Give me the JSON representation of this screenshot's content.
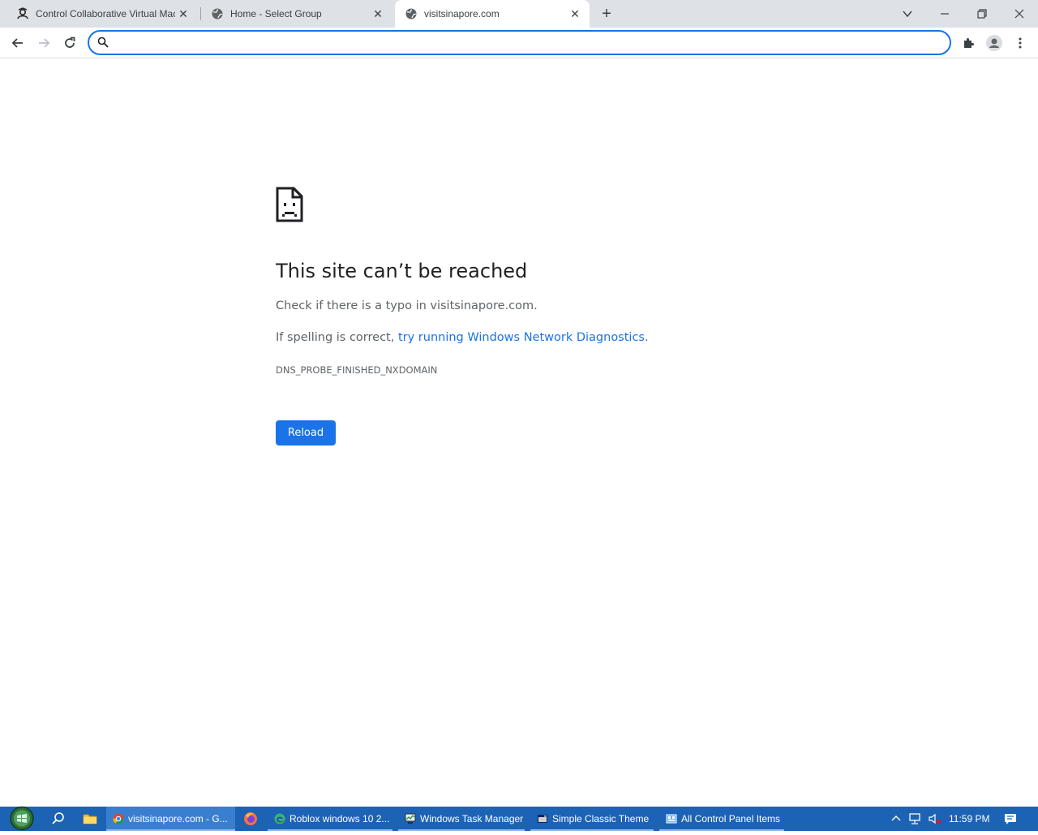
{
  "browser": {
    "tabs": [
      {
        "title": "Control Collaborative Virtual Machine",
        "favicon": "person-shield-icon",
        "active": false
      },
      {
        "title": "Home - Select Group",
        "favicon": "globe-icon",
        "active": false
      },
      {
        "title": "visitsinapore.com",
        "favicon": "globe-icon",
        "active": true
      }
    ],
    "new_tab": "+",
    "omnibox": {
      "value": "",
      "placeholder": ""
    }
  },
  "error_page": {
    "title": "This site can’t be reached",
    "typo_line": "Check if there is a typo in visitsinapore.com.",
    "spelling_prefix": "If spelling is correct, ",
    "diagnostics_link": "try running Windows Network Diagnostics",
    "spelling_suffix": ".",
    "error_code": "DNS_PROBE_FINISHED_NXDOMAIN",
    "reload_label": "Reload"
  },
  "taskbar": {
    "items": [
      {
        "label": "visitsinapore.com - G...",
        "icon": "chrome-icon",
        "active": true
      },
      {
        "label": "Roblox windows 10 2...",
        "icon": "edge-icon",
        "active": false
      },
      {
        "label": "Windows Task Manager",
        "icon": "task-manager-icon",
        "active": false
      },
      {
        "label": "Simple Classic Theme",
        "icon": "theme-icon",
        "active": false
      },
      {
        "label": "All Control Panel Items",
        "icon": "control-panel-icon",
        "active": false
      }
    ],
    "clock": "11:59 PM"
  },
  "colors": {
    "accent": "#1a73e8",
    "taskbar": "#1c63b5",
    "tabstrip": "#dee1e6"
  }
}
